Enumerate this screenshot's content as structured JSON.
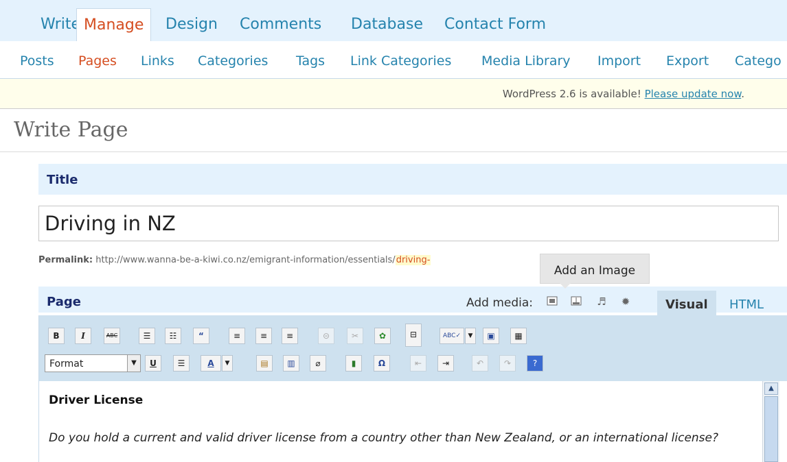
{
  "top_tabs": [
    {
      "label": "Write"
    },
    {
      "label": "Manage"
    },
    {
      "label": "Design"
    },
    {
      "label": "Comments"
    },
    {
      "label": "Database"
    },
    {
      "label": "Contact Form"
    }
  ],
  "sub_tabs": [
    {
      "label": "Posts"
    },
    {
      "label": "Pages"
    },
    {
      "label": "Links"
    },
    {
      "label": "Categories"
    },
    {
      "label": "Tags"
    },
    {
      "label": "Link Categories"
    },
    {
      "label": "Media Library"
    },
    {
      "label": "Import"
    },
    {
      "label": "Export"
    },
    {
      "label": "Catego"
    }
  ],
  "update": {
    "message": "WordPress 2.6 is available! ",
    "link": "Please update now",
    "suffix": "."
  },
  "page_title": "Write Page",
  "title_section": {
    "label": "Title",
    "value": "Driving in NZ"
  },
  "permalink": {
    "label": "Permalink:",
    "url": " http://www.wanna-be-a-kiwi.co.nz/emigrant-information/essentials/",
    "slug": "driving-"
  },
  "tooltip": "Add an Image",
  "editor": {
    "section_label": "Page",
    "add_media_label": "Add media:",
    "tabs": {
      "visual": "Visual",
      "html": "HTML"
    },
    "format_select": "Format",
    "content_heading": "Driver License",
    "content_paragraph": "Do you hold a current and valid driver license from a country other than New Zealand, or an international license?"
  }
}
